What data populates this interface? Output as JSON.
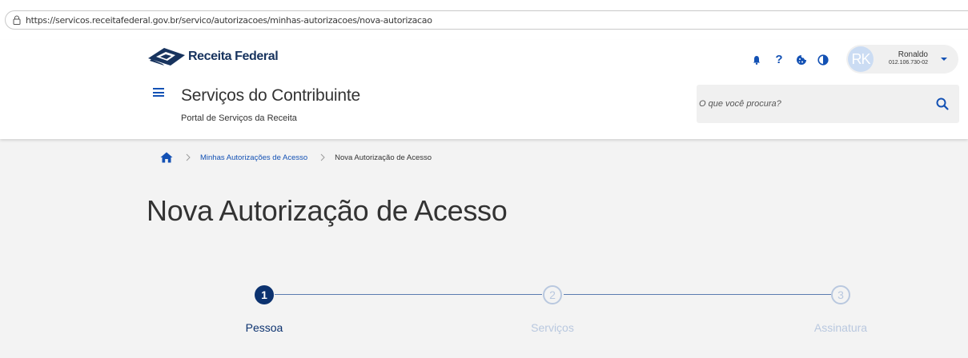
{
  "browser": {
    "url": "https://servicos.receitafederal.gov.br/servico/autorizacoes/minhas-autorizacoes/nova-autorizacao"
  },
  "header": {
    "logo_text": "Receita Federal",
    "app_title": "Serviços do Contribuinte",
    "app_subtitle": "Portal de Serviços da Receita",
    "icons": [
      "bell-icon",
      "help-icon",
      "cookie-icon",
      "contrast-icon"
    ],
    "user": {
      "initials": "RK",
      "name": "Ronaldo",
      "cpf": "012.106.730-02"
    },
    "search": {
      "placeholder": "O que você procura?"
    }
  },
  "breadcrumb": {
    "items": [
      "Minhas Autorizações de Acesso",
      "Nova Autorização de Acesso"
    ]
  },
  "page": {
    "title": "Nova Autorização de Acesso"
  },
  "stepper": {
    "steps": [
      {
        "number": "1",
        "label": "Pessoa",
        "active": true
      },
      {
        "number": "2",
        "label": "Serviços",
        "active": false
      },
      {
        "number": "3",
        "label": "Assinatura",
        "active": false
      }
    ]
  },
  "colors": {
    "primary": "#1351b4",
    "primary_dark": "#0c326f",
    "inactive": "#b9c8df",
    "page_bg": "#f3f3f3"
  }
}
